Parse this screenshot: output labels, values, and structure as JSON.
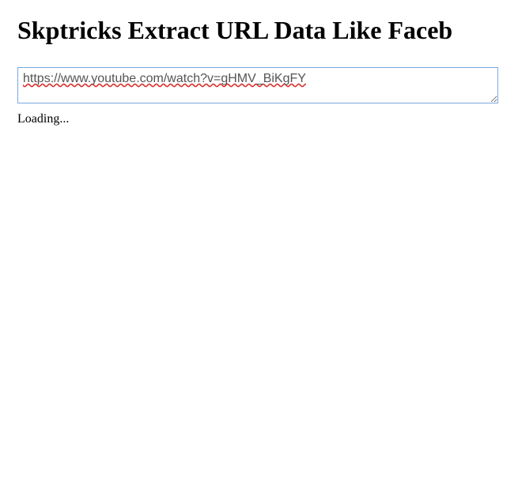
{
  "header": {
    "title": "Skptricks Extract URL Data Like Faceb"
  },
  "form": {
    "url_value": "https://www.youtube.com/watch?v=gHMV_BiKgFY"
  },
  "status": {
    "text": "Loading..."
  }
}
